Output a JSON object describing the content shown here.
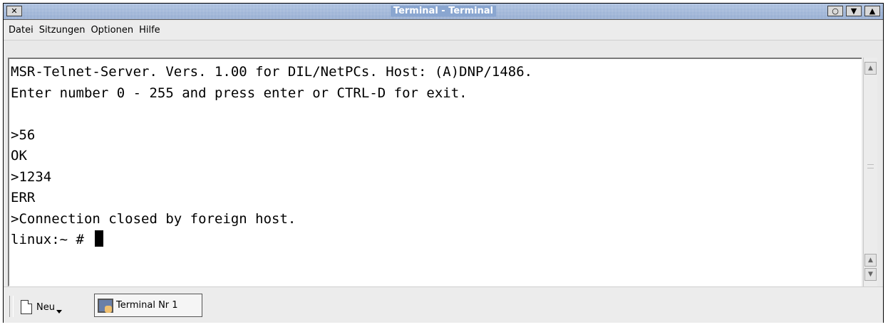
{
  "window": {
    "title": "Terminal - Terminal",
    "close_symbol": "✕",
    "min_symbol": "○",
    "shade_symbol": "▼",
    "max_symbol": "▲"
  },
  "menu": {
    "items": [
      "Datei",
      "Sitzungen",
      "Optionen",
      "Hilfe"
    ]
  },
  "terminal": {
    "lines": [
      "MSR-Telnet-Server. Vers. 1.00 for DIL/NetPCs. Host: (A)DNP/1486.",
      "Enter number 0 - 255 and press enter or CTRL-D for exit.",
      "",
      ">56",
      "OK",
      ">1234",
      "ERR",
      ">Connection closed by foreign host.",
      "linux:~ # "
    ]
  },
  "scrollbar": {
    "up_symbol": "▲",
    "down_symbol": "▼"
  },
  "tabbar": {
    "new_label": "Neu",
    "tabs": [
      {
        "label": "Terminal Nr 1",
        "icon": "terminal-monitor-icon"
      }
    ]
  },
  "colors": {
    "titlebar": "#8aa6d0",
    "background": "#ececec",
    "terminal_bg": "#ffffff"
  }
}
